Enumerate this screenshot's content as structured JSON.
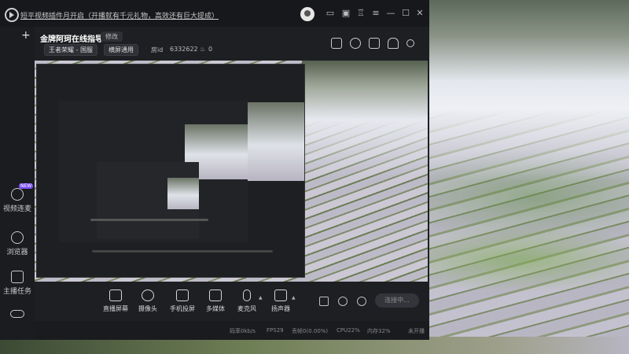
{
  "titlebar": {
    "announcement": "短平视频插件月开启（开播就有千元礼物，高效还有巨大提成）",
    "icons": [
      "message-icon",
      "box-icon",
      "shirt-icon",
      "menu-icon",
      "minimize-icon",
      "maximize-icon",
      "close-icon"
    ]
  },
  "sidebar": {
    "add_label": "+",
    "items": [
      {
        "label": "视频连麦",
        "badge": "NEW",
        "icon": "video-link-icon"
      },
      {
        "label": "浏览器",
        "icon": "browser-icon"
      },
      {
        "label": "主播任务",
        "icon": "task-icon"
      }
    ]
  },
  "header": {
    "room_title": "金牌阿珂在线指导",
    "edit_label": "修改",
    "category_tag": "王者荣耀 - 国服",
    "mode_tag": "横屏通用",
    "room_id_label": "房id",
    "room_id": "6332622",
    "fire_count": "0",
    "icons": [
      "layers-icon",
      "lock-icon",
      "layout-icon",
      "bell-icon",
      "share-icon"
    ]
  },
  "controls": [
    {
      "label": "直播屏幕",
      "icon": "screen-icon"
    },
    {
      "label": "摄像头",
      "icon": "camera-icon"
    },
    {
      "label": "手机投屏",
      "icon": "phone-cast-icon"
    },
    {
      "label": "多媒体",
      "icon": "media-icon"
    },
    {
      "label": "麦克风",
      "icon": "mic-icon"
    },
    {
      "label": "扬声器",
      "icon": "speaker-icon"
    }
  ],
  "connect_label": "连接中...",
  "status": {
    "bitrate": "码率0kb/s",
    "fps": "FPS29",
    "drop": "丢帧0(0.00%)",
    "cpu": "CPU22%",
    "mem": "内存32%",
    "live_state": "未开播"
  }
}
